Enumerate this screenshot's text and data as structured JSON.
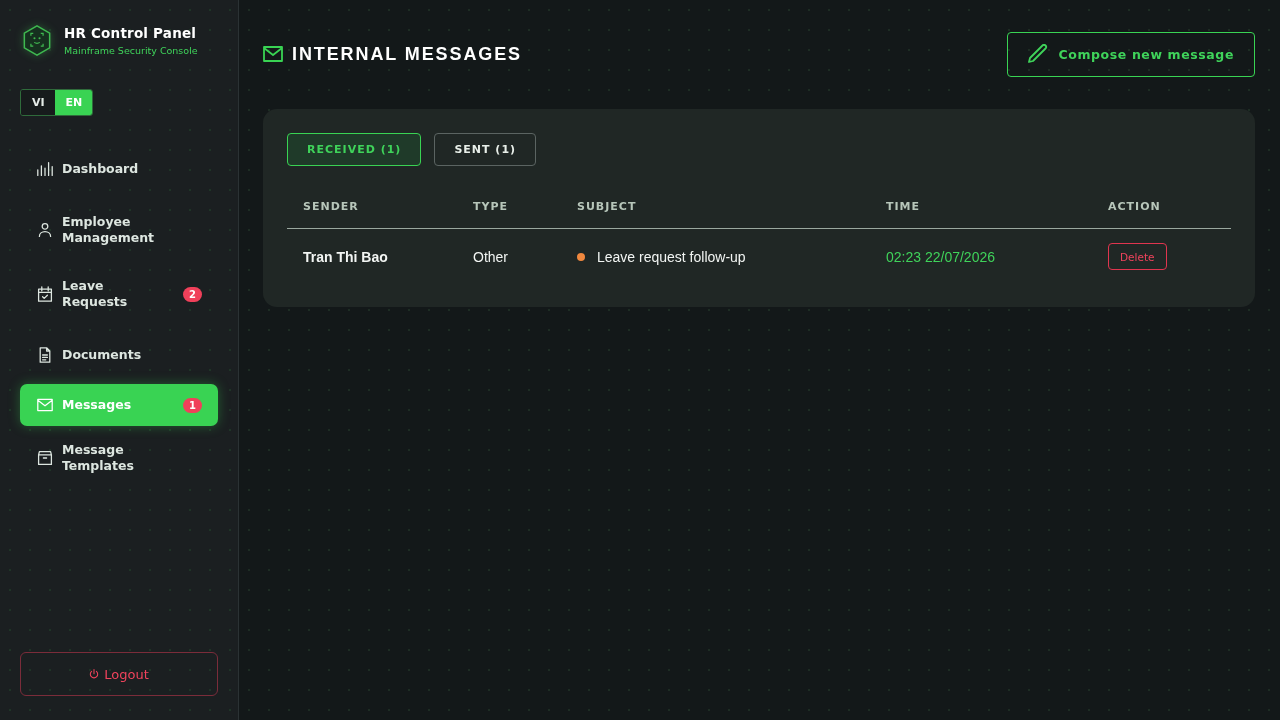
{
  "sidebar": {
    "brand": {
      "title": "HR Control Panel",
      "subtitle": "Mainframe Security Console"
    },
    "languages": [
      {
        "label": "VI",
        "selected": false
      },
      {
        "label": "EN",
        "selected": true
      }
    ],
    "nav": [
      {
        "label": "Dashboard",
        "selected": false
      },
      {
        "label": "Employee Management",
        "selected": false
      },
      {
        "label": "Leave Requests",
        "selected": false,
        "badge": "2"
      },
      {
        "label": "Documents",
        "selected": false
      },
      {
        "label": "Messages",
        "selected": true,
        "badge": "1"
      },
      {
        "label": "Message Templates",
        "selected": false
      }
    ],
    "logout": "Logout"
  },
  "header": {
    "title": "INTERNAL MESSAGES",
    "compose_button": "Compose new message"
  },
  "tabs": [
    {
      "label": "RECEIVED (1)",
      "selected": true
    },
    {
      "label": "SENT (1)",
      "selected": false
    }
  ],
  "table": {
    "columns": [
      "SENDER",
      "TYPE",
      "SUBJECT",
      "TIME",
      "ACTION"
    ],
    "rows": [
      {
        "sender": "Tran Thi Bao",
        "type": "Other",
        "unread": true,
        "subject": "Leave request follow-up",
        "time": "02:23 22/07/2026",
        "action": "Delete"
      }
    ]
  }
}
